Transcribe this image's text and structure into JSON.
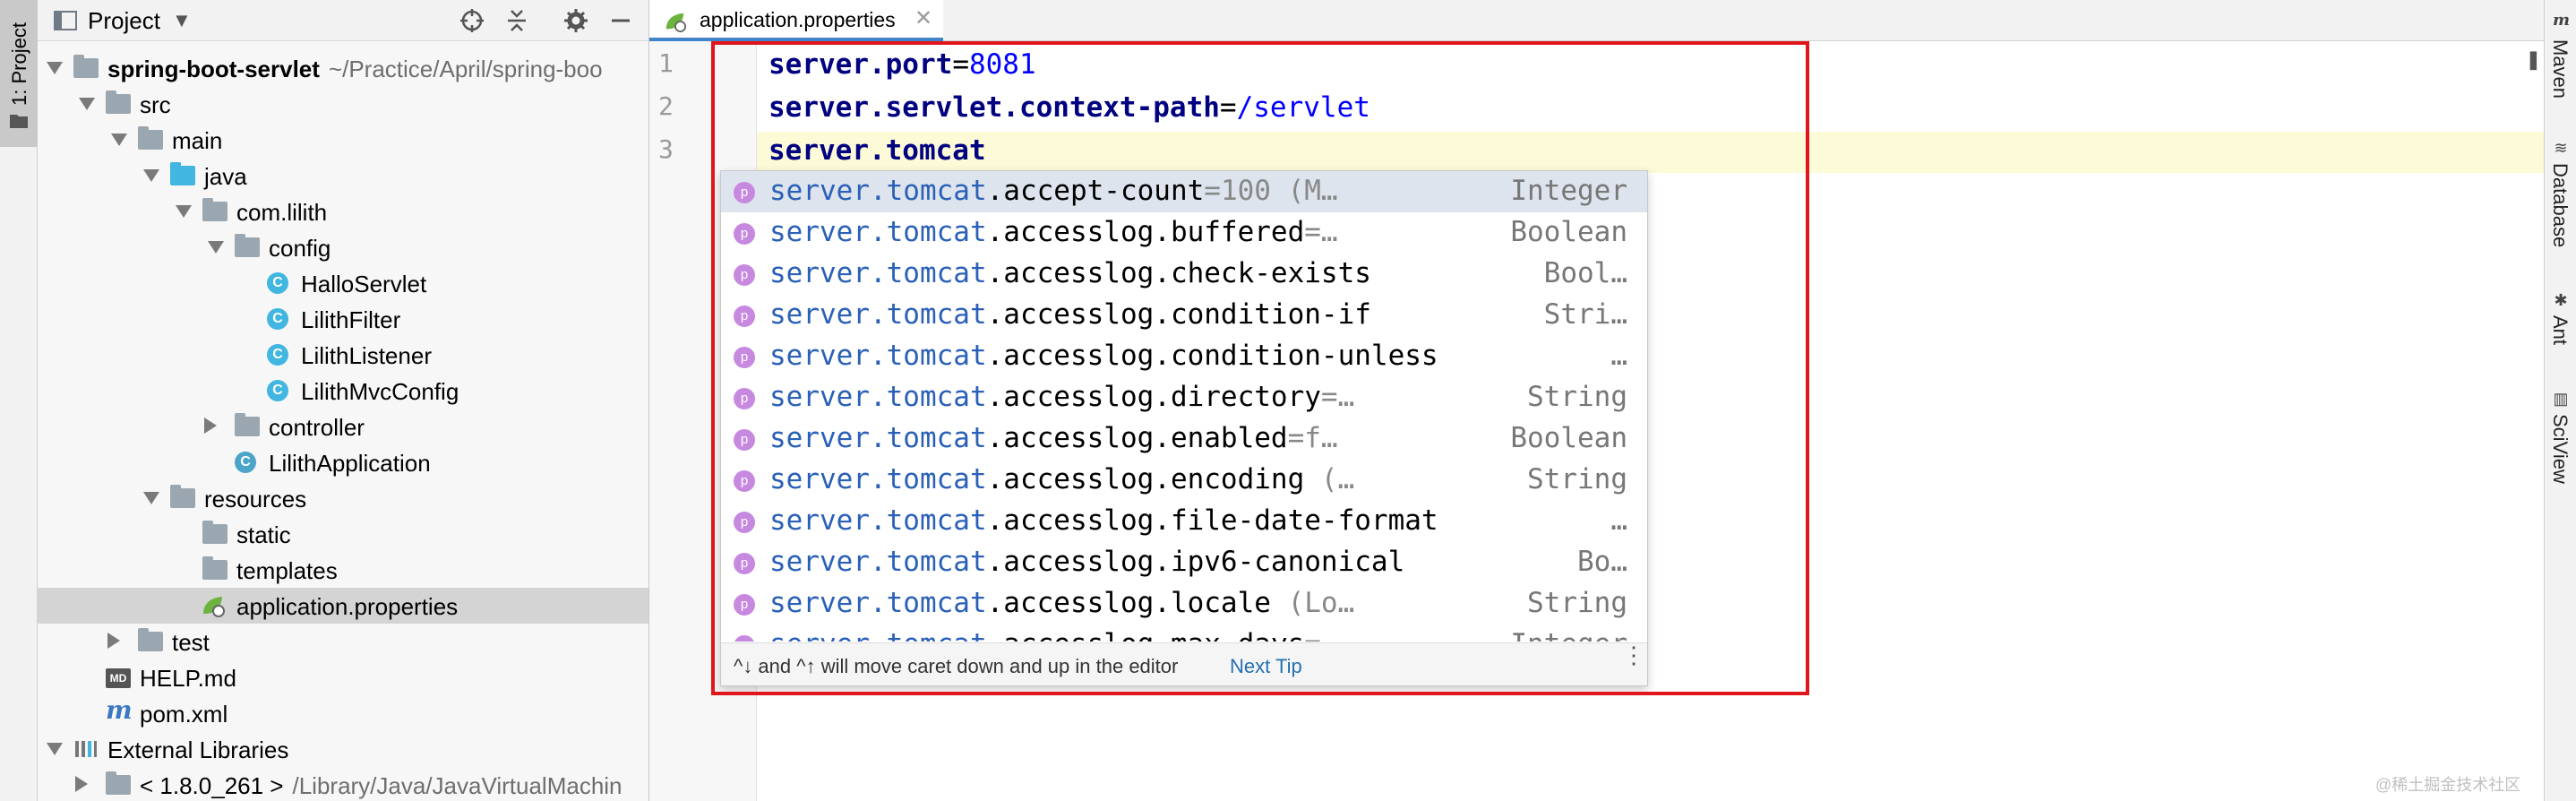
{
  "left_stripe": {
    "tool_window": "1: Project"
  },
  "project_panel": {
    "title": "Project",
    "tree": [
      {
        "label": "spring-boot-servlet",
        "path": "~/Practice/April/spring-boo",
        "icon": "folder",
        "expanded": true,
        "level": 0
      },
      {
        "label": "src",
        "icon": "folder",
        "expanded": true,
        "level": 1
      },
      {
        "label": "main",
        "icon": "folder",
        "expanded": true,
        "level": 2
      },
      {
        "label": "java",
        "icon": "folder-source",
        "expanded": true,
        "level": 3
      },
      {
        "label": "com.lilith",
        "icon": "package",
        "expanded": true,
        "level": 4
      },
      {
        "label": "config",
        "icon": "package",
        "expanded": true,
        "level": 5
      },
      {
        "label": "HalloServlet",
        "icon": "class",
        "level": 6
      },
      {
        "label": "LilithFilter",
        "icon": "class",
        "level": 6
      },
      {
        "label": "LilithListener",
        "icon": "class",
        "level": 6
      },
      {
        "label": "LilithMvcConfig",
        "icon": "class",
        "level": 6
      },
      {
        "label": "controller",
        "icon": "package",
        "expanded": false,
        "level": 5
      },
      {
        "label": "LilithApplication",
        "icon": "spring-class",
        "level": 5
      },
      {
        "label": "resources",
        "icon": "folder-resources",
        "expanded": true,
        "level": 3
      },
      {
        "label": "static",
        "icon": "folder",
        "level": 4
      },
      {
        "label": "templates",
        "icon": "folder",
        "level": 4
      },
      {
        "label": "application.properties",
        "icon": "spring-properties",
        "level": 4,
        "selected": true
      },
      {
        "label": "test",
        "icon": "folder",
        "expanded": false,
        "level": 2
      },
      {
        "label": "HELP.md",
        "icon": "markdown",
        "level": 1
      },
      {
        "label": "pom.xml",
        "icon": "maven",
        "level": 1
      },
      {
        "label": "External Libraries",
        "icon": "libraries",
        "expanded": true,
        "level": 0
      },
      {
        "label": "< 1.8.0_261 >",
        "path": "/Library/Java/JavaVirtualMachin",
        "icon": "jdk",
        "expanded": false,
        "level": 1
      }
    ]
  },
  "editor": {
    "tab": {
      "label": "application.properties"
    },
    "lines": [
      {
        "number": "1",
        "key": "server.port",
        "eq": "=",
        "value": "8081"
      },
      {
        "number": "2",
        "key": "server.servlet.context-path",
        "eq": "=",
        "value": "/servlet"
      },
      {
        "number": "3",
        "key": "server.tomcat",
        "eq": "",
        "value": ""
      }
    ]
  },
  "completion": {
    "items": [
      {
        "prefix": "server.tomcat",
        "rest": ".accept-count",
        "tail": "=100 (M…",
        "type": "Integer",
        "selected": true
      },
      {
        "prefix": "server.tomcat",
        "rest": ".accesslog.buffered",
        "tail": "=…",
        "type": "Boolean"
      },
      {
        "prefix": "server.tomcat",
        "rest": ".accesslog.check-exists",
        "tail": "",
        "type": "Bool…"
      },
      {
        "prefix": "server.tomcat",
        "rest": ".accesslog.condition-if",
        "tail": "",
        "type": "Stri…"
      },
      {
        "prefix": "server.tomcat",
        "rest": ".accesslog.condition-unless",
        "tail": "",
        "type": "…"
      },
      {
        "prefix": "server.tomcat",
        "rest": ".accesslog.directory",
        "tail": "=…",
        "type": "String"
      },
      {
        "prefix": "server.tomcat",
        "rest": ".accesslog.enabled",
        "tail": "=f…",
        "type": "Boolean"
      },
      {
        "prefix": "server.tomcat",
        "rest": ".accesslog.encoding",
        "tail": " (…",
        "type": "String"
      },
      {
        "prefix": "server.tomcat",
        "rest": ".accesslog.file-date-format",
        "tail": "",
        "type": "…"
      },
      {
        "prefix": "server.tomcat",
        "rest": ".accesslog.ipv6-canonical",
        "tail": "",
        "type": "Bo…"
      },
      {
        "prefix": "server.tomcat",
        "rest": ".accesslog.locale",
        "tail": " (Lo…",
        "type": "String"
      },
      {
        "prefix": "server.tomcat",
        "rest": ".accesslog.max-days",
        "tail": "=…",
        "type": "Integer"
      }
    ],
    "footer_hint": "^↓ and ^↑ will move caret down and up in the editor",
    "footer_link": "Next Tip"
  },
  "right_stripe": [
    "Maven",
    "Database",
    "Ant",
    "SciView"
  ],
  "watermark": "@稀土掘金技术社区",
  "colors": {
    "accent": "#4083c9",
    "annotation": "#e0161c",
    "caret_line": "#fcfad7",
    "selection": "#d4d4d4"
  }
}
